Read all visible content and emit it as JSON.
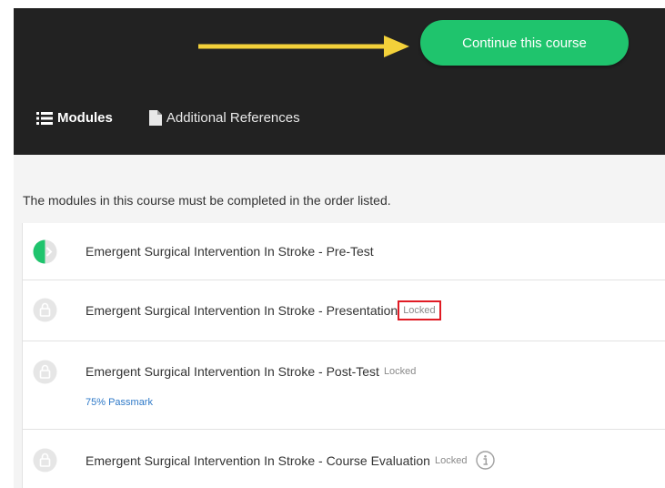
{
  "header": {
    "continue_label": "Continue this course",
    "arrow_color": "#f3d13a",
    "button_color": "#1fc46d",
    "background": "#222222"
  },
  "tabs": [
    {
      "label": "Modules",
      "icon": "list-icon"
    },
    {
      "label": "Additional References",
      "icon": "document-icon"
    }
  ],
  "intro_text": "The modules in this course must be completed in the order listed.",
  "modules": [
    {
      "title": "Emergent Surgical Intervention In Stroke - Pre-Test",
      "status": "in-progress",
      "status_icon": "half-progress-icon"
    },
    {
      "title": "Emergent Surgical Intervention In Stroke - Presentation",
      "status_label": "Locked",
      "status_icon": "lock-icon"
    },
    {
      "title": "Emergent Surgical Intervention In Stroke - Post-Test",
      "status_label": "Locked",
      "passmark": "75% Passmark",
      "status_icon": "lock-icon"
    },
    {
      "title": "Emergent Surgical Intervention In Stroke - Course Evaluation",
      "status_label": "Locked",
      "status_icon": "lock-icon",
      "extra_icon": "info-icon"
    }
  ]
}
